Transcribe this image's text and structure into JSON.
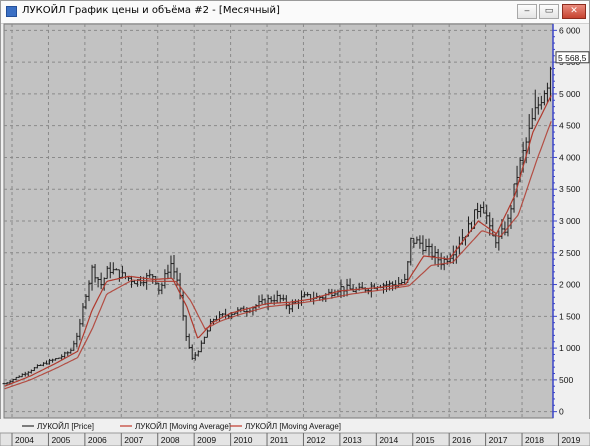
{
  "window": {
    "title": "ЛУКОЙЛ График цены и объёма #2 - [Месячный]",
    "minimize_glyph": "‒",
    "restore_glyph": "▭",
    "close_glyph": "✕"
  },
  "chart_data": {
    "type": "line",
    "period": "monthly",
    "price_marker": "5 568,5",
    "ylim": [
      -100,
      6100
    ],
    "y_ticks": [
      0,
      500,
      1000,
      1500,
      2000,
      2500,
      3000,
      3500,
      4000,
      4500,
      5000,
      5500,
      6000
    ],
    "y_tick_labels": [
      "0",
      "500",
      "1 000",
      "1 500",
      "2 000",
      "2 500",
      "3 000",
      "3 500",
      "4 000",
      "4 500",
      "5 000",
      "5 500",
      "6 000"
    ],
    "x_start": 2003.78,
    "x_end": 2018.85,
    "year_labels": [
      "2004",
      "2005",
      "2006",
      "2007",
      "2008",
      "2009",
      "2010",
      "2011",
      "2012",
      "2013",
      "2014",
      "2015",
      "2016",
      "2017",
      "2018",
      "2019"
    ],
    "legend": [
      {
        "name": "ЛУКОЙЛ [Price]",
        "color": "#303030"
      },
      {
        "name": "ЛУКОЙЛ [Moving Average]",
        "color": "#c0392b"
      },
      {
        "name": "ЛУКОЙЛ [Moving Average]",
        "color": "#c0392b"
      }
    ],
    "price_key_points": [
      {
        "t": 2003.8,
        "v": 440
      },
      {
        "t": 2004.2,
        "v": 560
      },
      {
        "t": 2004.6,
        "v": 680
      },
      {
        "t": 2004.9,
        "v": 760
      },
      {
        "t": 2005.3,
        "v": 850
      },
      {
        "t": 2005.6,
        "v": 950
      },
      {
        "t": 2005.85,
        "v": 1300
      },
      {
        "t": 2006.0,
        "v": 1800
      },
      {
        "t": 2006.2,
        "v": 2250
      },
      {
        "t": 2006.45,
        "v": 2000
      },
      {
        "t": 2006.65,
        "v": 2250
      },
      {
        "t": 2007.0,
        "v": 2150
      },
      {
        "t": 2007.4,
        "v": 2050
      },
      {
        "t": 2007.9,
        "v": 2150
      },
      {
        "t": 2008.05,
        "v": 1900
      },
      {
        "t": 2008.35,
        "v": 2350
      },
      {
        "t": 2008.55,
        "v": 2050
      },
      {
        "t": 2008.75,
        "v": 1250
      },
      {
        "t": 2008.95,
        "v": 820
      },
      {
        "t": 2009.2,
        "v": 1050
      },
      {
        "t": 2009.5,
        "v": 1450
      },
      {
        "t": 2010.0,
        "v": 1550
      },
      {
        "t": 2010.5,
        "v": 1620
      },
      {
        "t": 2011.0,
        "v": 1750
      },
      {
        "t": 2011.3,
        "v": 1800
      },
      {
        "t": 2011.6,
        "v": 1650
      },
      {
        "t": 2012.0,
        "v": 1800
      },
      {
        "t": 2012.5,
        "v": 1800
      },
      {
        "t": 2013.0,
        "v": 1950
      },
      {
        "t": 2013.5,
        "v": 1900
      },
      {
        "t": 2014.0,
        "v": 2000
      },
      {
        "t": 2014.5,
        "v": 2000
      },
      {
        "t": 2014.8,
        "v": 2050
      },
      {
        "t": 2014.95,
        "v": 2700
      },
      {
        "t": 2015.2,
        "v": 2650
      },
      {
        "t": 2015.5,
        "v": 2500
      },
      {
        "t": 2015.8,
        "v": 2350
      },
      {
        "t": 2016.0,
        "v": 2450
      },
      {
        "t": 2016.3,
        "v": 2700
      },
      {
        "t": 2016.6,
        "v": 2950
      },
      {
        "t": 2016.85,
        "v": 3300
      },
      {
        "t": 2017.0,
        "v": 3150
      },
      {
        "t": 2017.15,
        "v": 2750
      },
      {
        "t": 2017.35,
        "v": 2700
      },
      {
        "t": 2017.6,
        "v": 2950
      },
      {
        "t": 2017.85,
        "v": 3700
      },
      {
        "t": 2018.0,
        "v": 4000
      },
      {
        "t": 2018.3,
        "v": 4600
      },
      {
        "t": 2018.55,
        "v": 5000
      },
      {
        "t": 2018.7,
        "v": 5200
      },
      {
        "t": 2018.82,
        "v": 5568.5
      }
    ],
    "ma_fast_key_points": [
      {
        "t": 2003.8,
        "v": 400
      },
      {
        "t": 2004.5,
        "v": 560
      },
      {
        "t": 2005.2,
        "v": 760
      },
      {
        "t": 2005.8,
        "v": 950
      },
      {
        "t": 2006.2,
        "v": 1600
      },
      {
        "t": 2006.6,
        "v": 2050
      },
      {
        "t": 2007.2,
        "v": 2130
      },
      {
        "t": 2007.9,
        "v": 2080
      },
      {
        "t": 2008.4,
        "v": 2100
      },
      {
        "t": 2008.8,
        "v": 1650
      },
      {
        "t": 2009.1,
        "v": 1150
      },
      {
        "t": 2009.5,
        "v": 1400
      },
      {
        "t": 2010.0,
        "v": 1550
      },
      {
        "t": 2011.0,
        "v": 1700
      },
      {
        "t": 2011.6,
        "v": 1720
      },
      {
        "t": 2012.2,
        "v": 1770
      },
      {
        "t": 2013.0,
        "v": 1900
      },
      {
        "t": 2014.0,
        "v": 1950
      },
      {
        "t": 2014.8,
        "v": 2000
      },
      {
        "t": 2015.3,
        "v": 2450
      },
      {
        "t": 2016.0,
        "v": 2400
      },
      {
        "t": 2016.8,
        "v": 3000
      },
      {
        "t": 2017.3,
        "v": 2800
      },
      {
        "t": 2017.8,
        "v": 3400
      },
      {
        "t": 2018.3,
        "v": 4400
      },
      {
        "t": 2018.82,
        "v": 5000
      }
    ],
    "ma_slow_key_points": [
      {
        "t": 2003.8,
        "v": 360
      },
      {
        "t": 2004.5,
        "v": 500
      },
      {
        "t": 2005.2,
        "v": 680
      },
      {
        "t": 2005.8,
        "v": 850
      },
      {
        "t": 2006.2,
        "v": 1300
      },
      {
        "t": 2006.6,
        "v": 1850
      },
      {
        "t": 2007.3,
        "v": 2070
      },
      {
        "t": 2008.0,
        "v": 2050
      },
      {
        "t": 2008.5,
        "v": 2050
      },
      {
        "t": 2008.9,
        "v": 1750
      },
      {
        "t": 2009.3,
        "v": 1300
      },
      {
        "t": 2009.7,
        "v": 1420
      },
      {
        "t": 2010.2,
        "v": 1520
      },
      {
        "t": 2011.0,
        "v": 1650
      },
      {
        "t": 2011.8,
        "v": 1700
      },
      {
        "t": 2012.5,
        "v": 1760
      },
      {
        "t": 2013.3,
        "v": 1850
      },
      {
        "t": 2014.2,
        "v": 1920
      },
      {
        "t": 2014.9,
        "v": 1980
      },
      {
        "t": 2015.5,
        "v": 2300
      },
      {
        "t": 2016.1,
        "v": 2350
      },
      {
        "t": 2016.9,
        "v": 2850
      },
      {
        "t": 2017.4,
        "v": 2750
      },
      {
        "t": 2017.9,
        "v": 3100
      },
      {
        "t": 2018.4,
        "v": 3950
      },
      {
        "t": 2018.82,
        "v": 4600
      }
    ],
    "grid": true
  },
  "colors": {
    "plot_bg": "#c2c2c2",
    "grid": "#8a8a8a",
    "price": "#1e1e1e",
    "ma": "#b03a2e",
    "axis_blue": "#3a44c8",
    "marker_bg": "#ffffff"
  }
}
